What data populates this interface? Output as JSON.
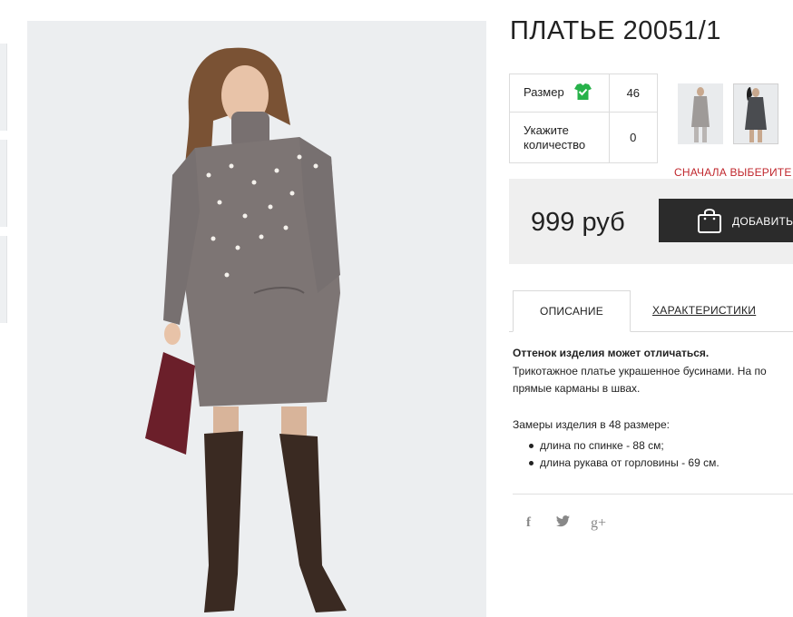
{
  "product": {
    "title": "ПЛАТЬЕ 20051/1",
    "options": {
      "size_label": "Размер",
      "size_value": "46",
      "quantity_label_line1": "Укажите",
      "quantity_label_line2": "количество",
      "quantity_value": "0"
    },
    "warning": "СНАЧАЛА ВЫБЕРИТЕ Р",
    "price": "999 руб",
    "add_button_label": "ДОБАВИТЬ"
  },
  "tabs": {
    "description": "ОПИСАНИЕ",
    "characteristics": "ХАРАКТЕРИСТИКИ"
  },
  "description": {
    "note": "Оттенок изделия может отличаться.",
    "text_line1": "Трикотажное платье украшенное бусинами. На по",
    "text_line2": "прямые карманы в швах.",
    "measure_heading": "Замеры изделия в 48 размере:",
    "measures": [
      "длина по спинке - 88 см;",
      "длина рукава от горловины - 69 см."
    ]
  },
  "social": {
    "facebook": "f",
    "twitter": "🐦",
    "google": "g+"
  },
  "colors": {
    "check_icon": "#27b24a",
    "warning": "#c0272d",
    "button": "#2b2b2b",
    "price_bg": "#efefef"
  }
}
